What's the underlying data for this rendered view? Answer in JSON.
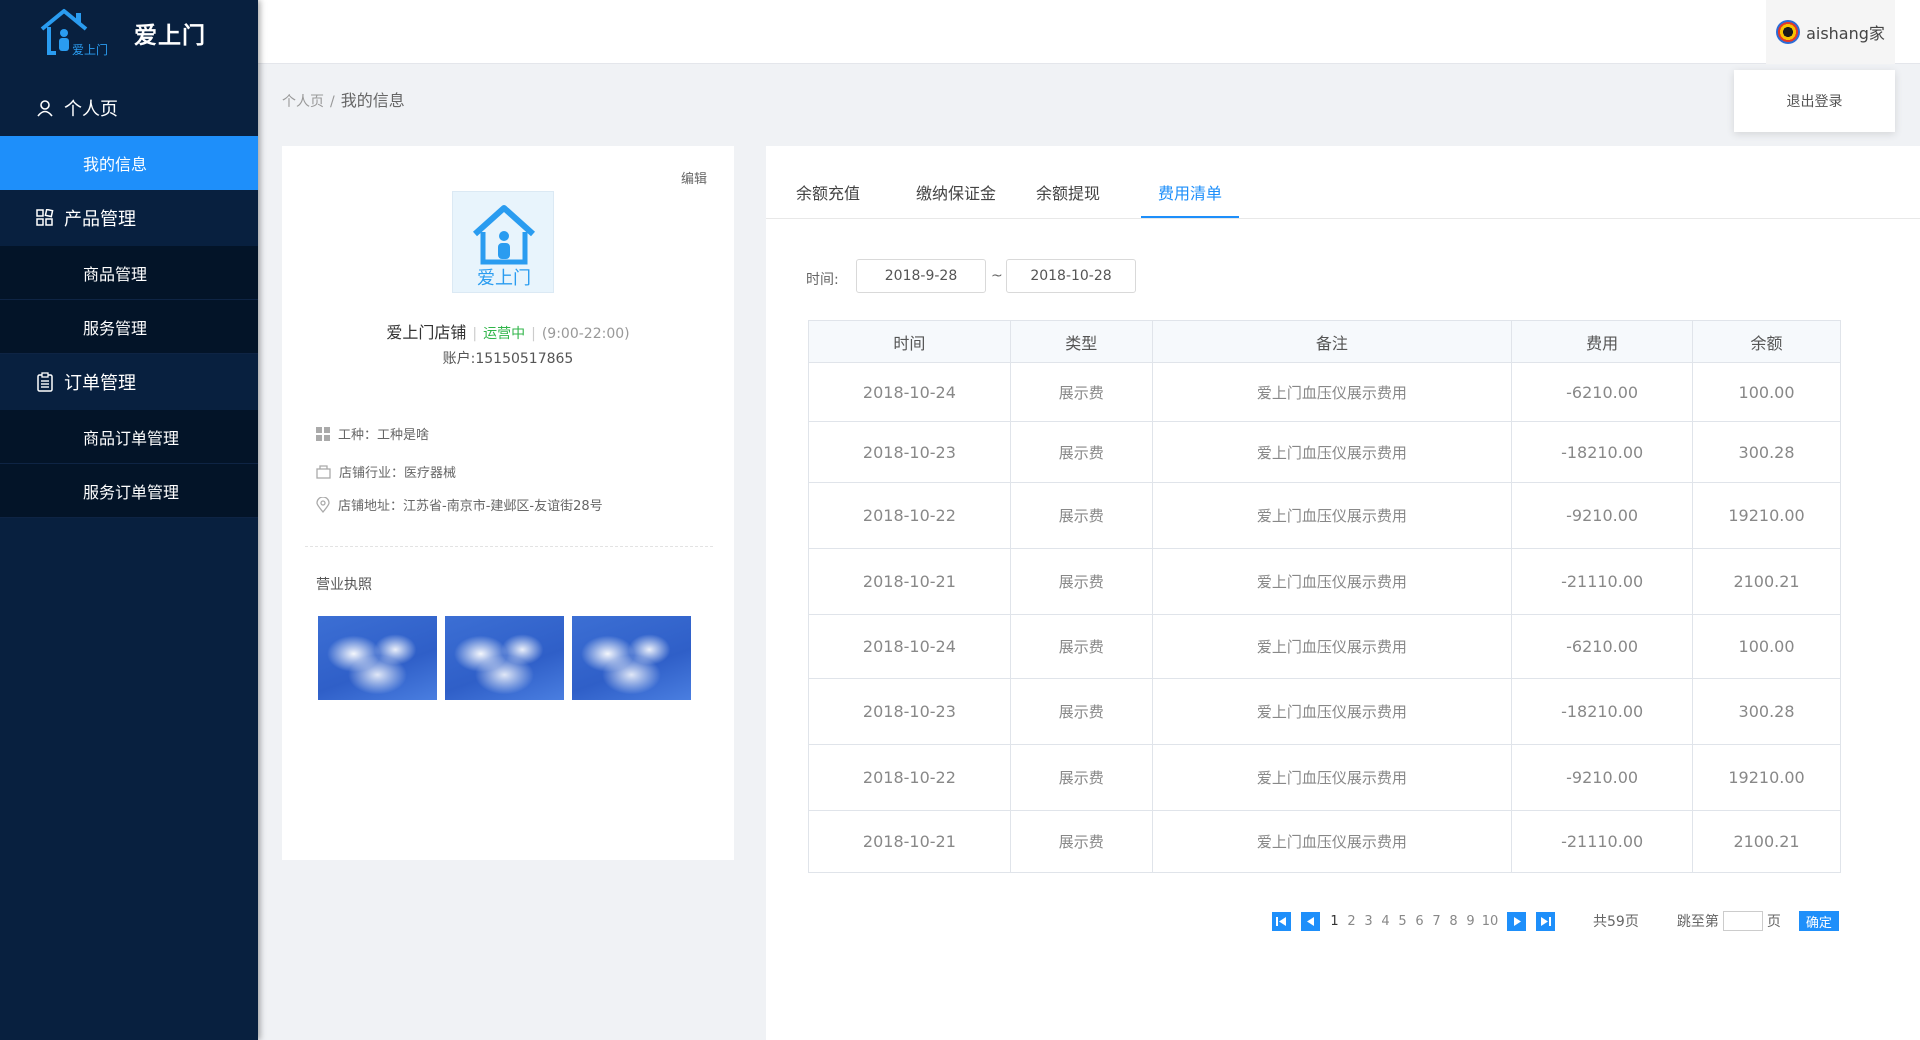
{
  "app": {
    "name": "爱上门",
    "logo_caption": "爱上门"
  },
  "sidebar": {
    "groups": [
      {
        "label": "个人页",
        "items": [
          "我的信息"
        ]
      },
      {
        "label": "产品管理",
        "items": [
          "商品管理",
          "服务管理"
        ]
      },
      {
        "label": "订单管理",
        "items": [
          "商品订单管理",
          "服务订单管理"
        ]
      }
    ],
    "active_item": "我的信息"
  },
  "header": {
    "user_name": "aishang家",
    "logout_label": "退出登录"
  },
  "breadcrumb": {
    "root": "个人页",
    "separator": "/",
    "current": "我的信息"
  },
  "profile": {
    "edit_label": "编辑",
    "shop_name": "爱上门店铺",
    "status": "运营中",
    "hours": "(9:00-22:00)",
    "account": "账户:15150517865",
    "work_type": "工种：工种是啥",
    "industry": "店铺行业：医疗器械",
    "address": "店铺地址：江苏省-南京市-建邺区-友谊街28号",
    "license_title": "营业执照"
  },
  "tabs": [
    {
      "label": "余额充值",
      "active": false
    },
    {
      "label": "缴纳保证金",
      "active": false
    },
    {
      "label": "余额提现",
      "active": false
    },
    {
      "label": "费用清单",
      "active": true
    }
  ],
  "filter": {
    "label": "时间:",
    "start": "2018-9-28",
    "separator": "~",
    "end": "2018-10-28"
  },
  "table": {
    "headers": [
      "时间",
      "类型",
      "备注",
      "费用",
      "余额"
    ],
    "rows": [
      [
        "2018-10-24",
        "展示费",
        "爱上门血压仪展示费用",
        "-6210.00",
        "100.00"
      ],
      [
        "2018-10-23",
        "展示费",
        "爱上门血压仪展示费用",
        "-18210.00",
        "300.28"
      ],
      [
        "2018-10-22",
        "展示费",
        "爱上门血压仪展示费用",
        "-9210.00",
        "19210.00"
      ],
      [
        "2018-10-21",
        "展示费",
        "爱上门血压仪展示费用",
        "-21110.00",
        "2100.21"
      ],
      [
        "2018-10-24",
        "展示费",
        "爱上门血压仪展示费用",
        "-6210.00",
        "100.00"
      ],
      [
        "2018-10-23",
        "展示费",
        "爱上门血压仪展示费用",
        "-18210.00",
        "300.28"
      ],
      [
        "2018-10-22",
        "展示费",
        "爱上门血压仪展示费用",
        "-9210.00",
        "19210.00"
      ],
      [
        "2018-10-21",
        "展示费",
        "爱上门血压仪展示费用",
        "-21110.00",
        "2100.21"
      ]
    ]
  },
  "pagination": {
    "pages": [
      "1",
      "2",
      "3",
      "4",
      "5",
      "6",
      "7",
      "8",
      "9",
      "10"
    ],
    "current": "1",
    "total": "共59页",
    "jump_label": "跳至第",
    "page_unit": "页",
    "confirm_label": "确定"
  },
  "colors": {
    "sidebar": "#08203f",
    "accent": "#1e8ffa",
    "status": "#31b54a"
  }
}
